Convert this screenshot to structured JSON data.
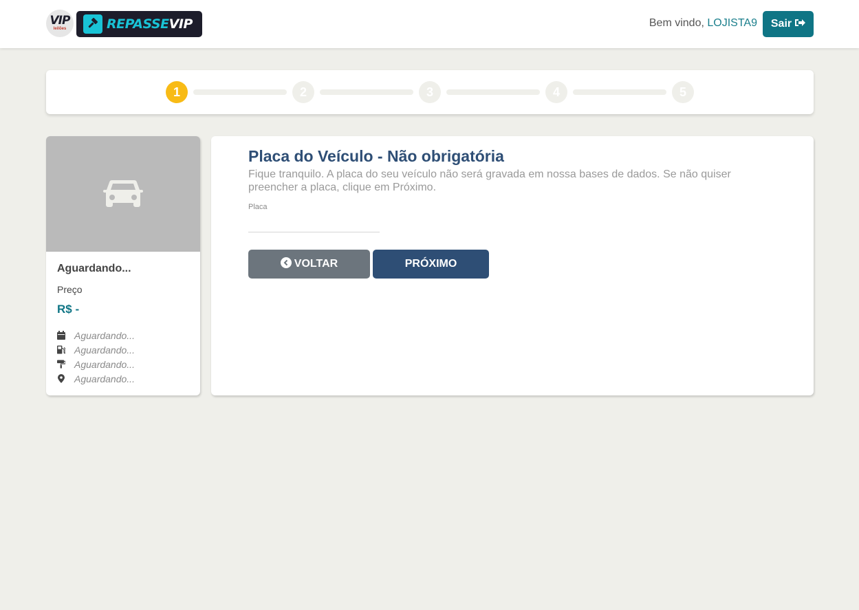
{
  "header": {
    "logo_vip_text": "VIP",
    "logo_vip_sub": "leilões",
    "brand_part1": "REPASSE",
    "brand_part2": "VIP",
    "welcome_prefix": "Bem vindo,",
    "username": "LOJISTA9",
    "logout_label": "Sair",
    "logout_icon": "sign-out-icon"
  },
  "stepper": {
    "current_step": 1,
    "steps": [
      "1",
      "2",
      "3",
      "4",
      "5"
    ]
  },
  "side_card": {
    "photo_icon": "car-icon",
    "title": "Aguardando...",
    "price_label": "Preço",
    "price_value": "R$ -",
    "info": [
      {
        "icon": "calendar-icon",
        "text": "Aguardando..."
      },
      {
        "icon": "fuel-pump-icon",
        "text": "Aguardando..."
      },
      {
        "icon": "paint-roller-icon",
        "text": "Aguardando..."
      },
      {
        "icon": "map-marker-icon",
        "text": "Aguardando..."
      }
    ]
  },
  "form": {
    "title": "Placa do Veículo - Não obrigatória",
    "description": "Fique tranquilo. A placa do seu veículo não será gravada em nossa bases de dados. Se não quiser preencher a placa, clique em Próximo.",
    "field_label": "Placa",
    "field_value": "",
    "field_placeholder": "",
    "back_label": "VOLTAR",
    "next_label": "PRÓXIMO"
  },
  "colors": {
    "background": "#efefea",
    "active_step": "#f8bb16",
    "primary_dark": "#2e4e75",
    "teal": "#0f7585",
    "brand_cyan": "#19c3d6",
    "secondary": "#6c757d"
  }
}
